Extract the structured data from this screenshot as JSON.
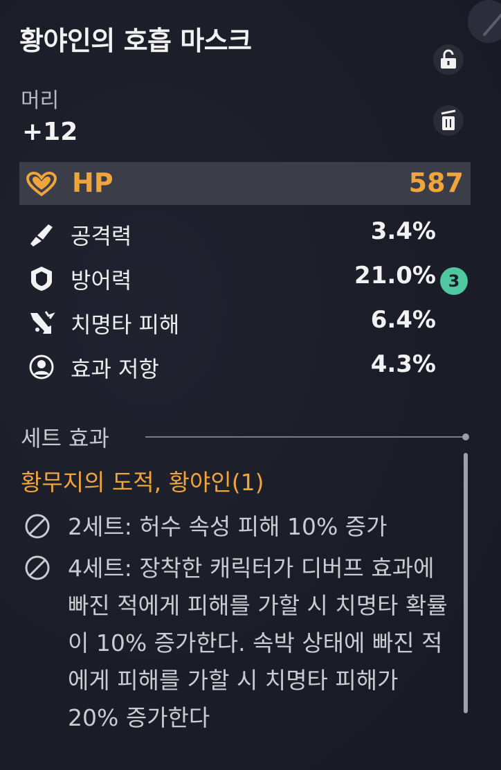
{
  "item": {
    "name": "황야인의 호흡 마스크",
    "slot": "머리",
    "level": "+12"
  },
  "main_stat": {
    "name": "HP",
    "value": "587",
    "icon": "heart-icon",
    "color": "#f0a53c"
  },
  "sub_stats": [
    {
      "name": "공격력",
      "value": "3.4%",
      "icon": "sword-icon"
    },
    {
      "name": "방어력",
      "value": "21.0%",
      "icon": "shield-icon",
      "upgrades": "3"
    },
    {
      "name": "치명타 피해",
      "value": "6.4%",
      "icon": "critical-icon"
    },
    {
      "name": "효과 저항",
      "value": "4.3%",
      "icon": "resist-icon"
    }
  ],
  "set_effect": {
    "header": "세트 효과",
    "name": "황무지의 도적, 황야인(1)",
    "effects": [
      {
        "text": "2세트: 허수 속성 피해 10% 증가",
        "icon": "prohibited-icon"
      },
      {
        "text": "4세트: 장착한 캐릭터가 디버프 효과에 빠진 적에게 피해를 가할 시 치명타 확률이 10% 증가한다. 속박 상태에 빠진 적에게 피해를 가할 시 치명타 피해가 20% 증가한다",
        "icon": "prohibited-icon"
      }
    ]
  },
  "colors": {
    "accent": "#f0a53c",
    "badge": "#4fc7a0",
    "background": "#1b1d29"
  }
}
